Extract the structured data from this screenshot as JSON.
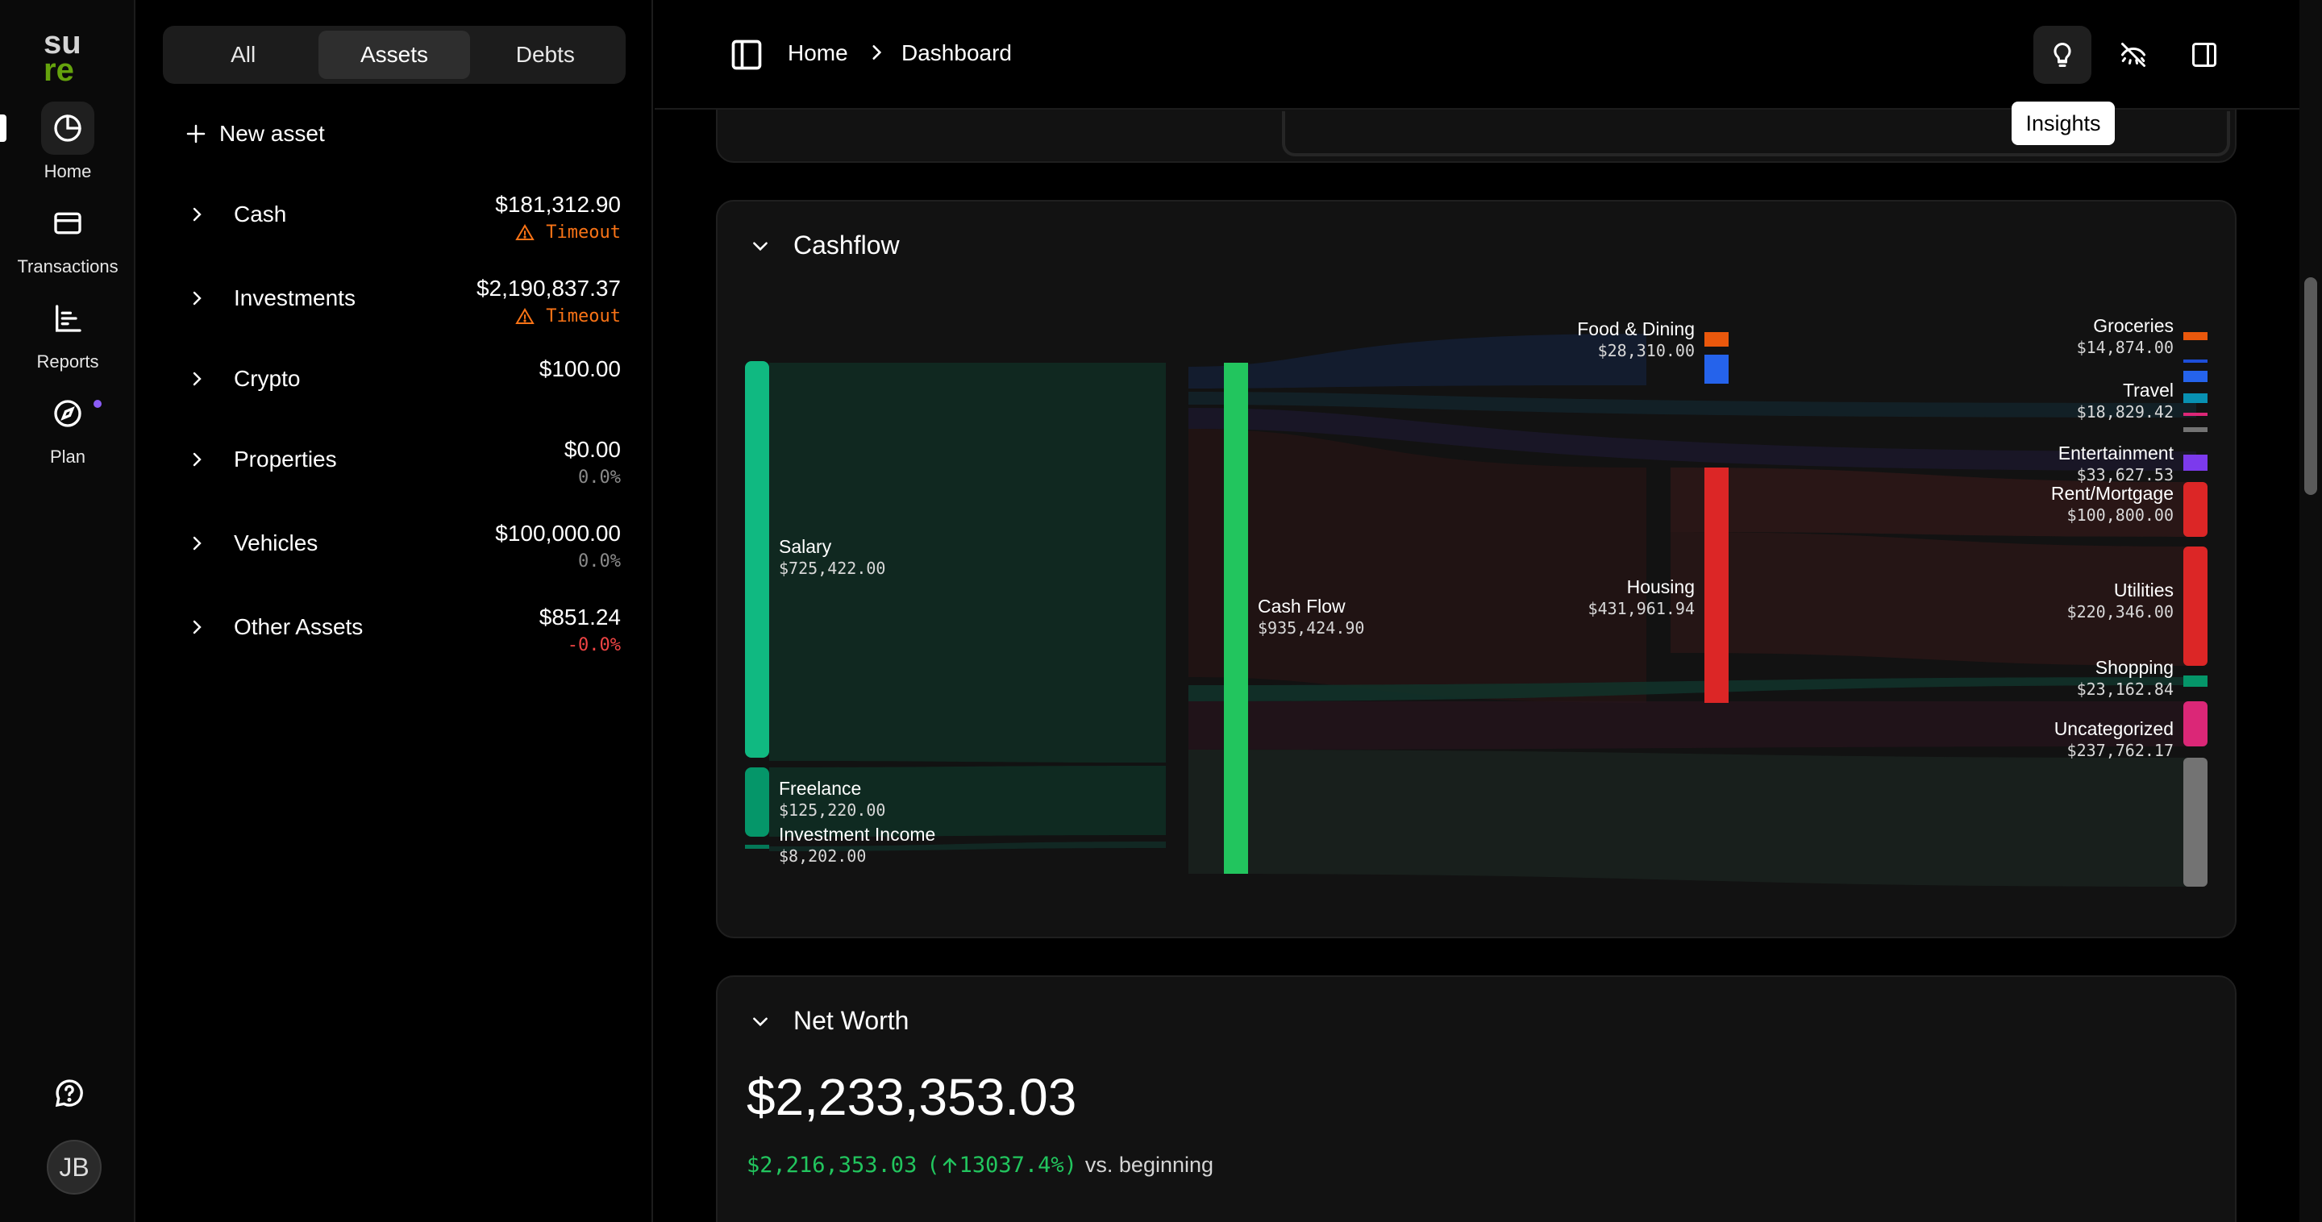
{
  "brand": {
    "logo_text": "sure",
    "logo_color": "#65a30d"
  },
  "rail": {
    "items": [
      {
        "label": "Home",
        "icon": "pie-chart-icon"
      },
      {
        "label": "Transactions",
        "icon": "credit-card-icon"
      },
      {
        "label": "Reports",
        "icon": "bar-chart-icon"
      },
      {
        "label": "Plan",
        "icon": "compass-icon"
      }
    ],
    "avatar_initials": "JB"
  },
  "accounts": {
    "tabs": [
      "All",
      "Assets",
      "Debts"
    ],
    "active_tab": "Assets",
    "new_label": "New asset",
    "groups": [
      {
        "name": "Cash",
        "balance": "$181,312.90",
        "sub": "Timeout",
        "sub_kind": "warn"
      },
      {
        "name": "Investments",
        "balance": "$2,190,837.37",
        "sub": "Timeout",
        "sub_kind": "warn"
      },
      {
        "name": "Crypto",
        "balance": "$100.00",
        "sub": "",
        "sub_kind": "none"
      },
      {
        "name": "Properties",
        "balance": "$0.00",
        "sub": "0.0%",
        "sub_kind": "muted"
      },
      {
        "name": "Vehicles",
        "balance": "$100,000.00",
        "sub": "0.0%",
        "sub_kind": "muted"
      },
      {
        "name": "Other Assets",
        "balance": "$851.24",
        "sub": "-0.0%",
        "sub_kind": "neg"
      }
    ]
  },
  "header": {
    "breadcrumb": [
      "Home",
      "Dashboard"
    ],
    "tooltip": "Insights"
  },
  "cashflow": {
    "title": "Cashflow",
    "sources": [
      {
        "label": "Salary",
        "value": "$725,422.00",
        "color": "#10b981"
      },
      {
        "label": "Freelance",
        "value": "$125,220.00",
        "color": "#059669"
      },
      {
        "label": "Investment Income",
        "value": "$8,202.00",
        "color": "#047857"
      }
    ],
    "center": {
      "label": "Cash Flow",
      "value": "$935,424.90",
      "color": "#22c55e"
    },
    "groups": [
      {
        "label": "Food & Dining",
        "value": "$28,310.00"
      },
      {
        "label": "Housing",
        "value": "$431,961.94",
        "color": "#dc2626"
      }
    ],
    "targets": [
      {
        "label": "Groceries",
        "value": "$14,874.00"
      },
      {
        "label": "Travel",
        "value": "$18,829.42"
      },
      {
        "label": "Entertainment",
        "value": "$33,627.53"
      },
      {
        "label": "Rent/Mortgage",
        "value": "$100,800.00"
      },
      {
        "label": "Utilities",
        "value": "$220,346.00"
      },
      {
        "label": "Shopping",
        "value": "$23,162.84"
      },
      {
        "label": "Uncategorized",
        "value": "$237,762.17"
      }
    ]
  },
  "networth": {
    "title": "Net Worth",
    "value": "$2,233,353.03",
    "change": "$2,216,353.03",
    "change_pct": "13037.4%",
    "vs_label": "vs. beginning"
  }
}
